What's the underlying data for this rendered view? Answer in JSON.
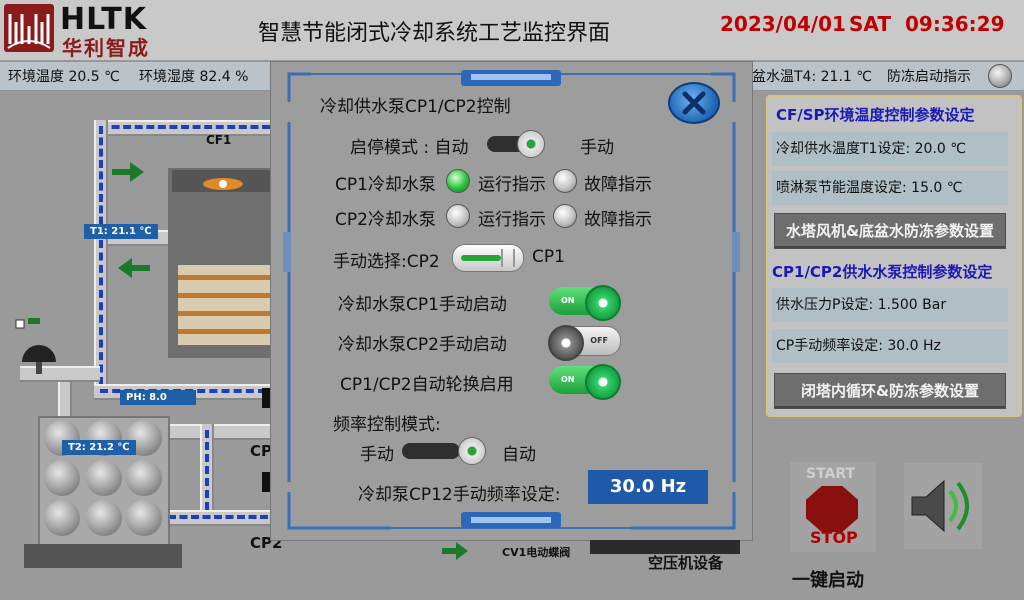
{
  "header": {
    "logo_en": "HLTK",
    "logo_cn": "华利智成",
    "title": "智慧节能闭式冷却系统工艺监控界面",
    "date": "2023/04/01",
    "weekday": "SAT",
    "time": "09:36:29"
  },
  "status_bar": {
    "env_temp": "环境温度 20.5 ℃",
    "env_humidity": "环境湿度 82.4 %",
    "basin_temp": "盆水温T4:  21.1 ℃",
    "antifreeze_indicator": "防冻启动指示"
  },
  "process": {
    "cf1": "CF1",
    "t1_tag": "T1:  21.1 ℃",
    "t2_tag": "T2:  21.2 ℃",
    "ph_tag": "PH:  8.0",
    "cp_label_1": "CP",
    "cp_label_2": "CP2",
    "valve_label": "CV1电动蝶阀",
    "compressor_label": "空压机设备"
  },
  "modal": {
    "title": "冷却供水泵CP1/CP2控制",
    "start_stop_mode_label": "启停模式 : 自动",
    "start_stop_mode_right": "手动",
    "cp1_pump_label": "CP1冷却水泵",
    "cp2_pump_label": "CP2冷却水泵",
    "run_indicator": "运行指示",
    "fault_indicator": "故障指示",
    "manual_select_label": "手动选择:CP2",
    "manual_select_right": "CP1",
    "cp1_manual_start_label": "冷却水泵CP1手动启动",
    "cp2_manual_start_label": "冷却水泵CP2手动启动",
    "auto_rotation_label": "CP1/CP2自动轮换启用",
    "toggle_on_text": "ON",
    "toggle_off_text": "OFF",
    "freq_mode_label": "频率控制模式:",
    "freq_mode_left": "手动",
    "freq_mode_right": "自动",
    "freq_setting_label": "冷却泵CP12手动频率设定:",
    "freq_setting_value": "30.0 Hz",
    "states": {
      "cp1_run": true,
      "cp1_fault": false,
      "cp2_run": false,
      "cp2_fault": false,
      "cp1_manual_start": "ON",
      "cp2_manual_start": "OFF",
      "auto_rotation": "ON"
    }
  },
  "right_panel": {
    "section1_heading": "CF/SP环境温度控制参数设定",
    "t1_setting": "冷却供水温度T1设定:   20.0  ℃",
    "spray_setting": "喷淋泵节能温度设定:   15.0  ℃",
    "tower_fan_button": "水塔风机&底盆水防冻参数设置",
    "section2_heading": "CP1/CP2供水水泵控制参数设定",
    "pressure_setting": "供水压力P设定:   1.500   Bar",
    "cp_freq_setting": "CP手动频率设定:    30.0   Hz",
    "closed_loop_button": "闭塔内循环&防冻参数设置"
  },
  "controls": {
    "start_label": "START",
    "stop_label": "STOP",
    "one_key_start": "一键启动"
  },
  "colors": {
    "header_date": "#c00000",
    "heading_blue": "#1a1ab8",
    "run_lamp_green": "#27c236",
    "value_box_blue": "#1e5aa8",
    "panel_border": "#d3c58a"
  }
}
